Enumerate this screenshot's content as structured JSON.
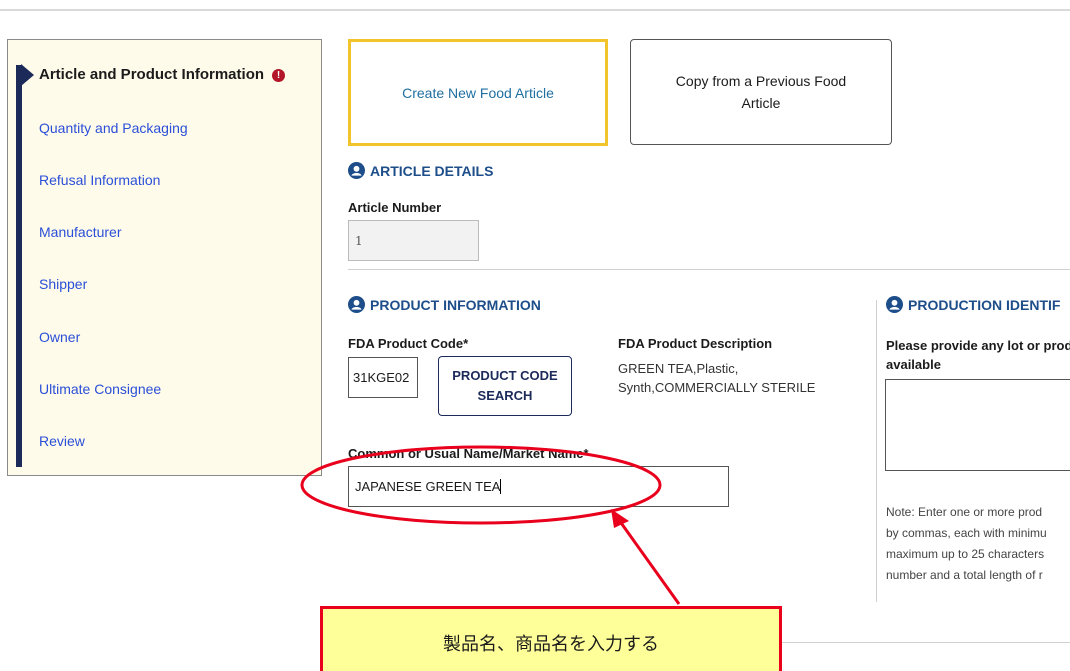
{
  "sidebar": {
    "items": [
      {
        "label": "Article and Product Information",
        "active": true,
        "alert": "!"
      },
      {
        "label": "Quantity and Packaging"
      },
      {
        "label": "Refusal Information"
      },
      {
        "label": "Manufacturer"
      },
      {
        "label": "Shipper"
      },
      {
        "label": "Owner"
      },
      {
        "label": "Ultimate Consignee"
      },
      {
        "label": "Review"
      }
    ]
  },
  "actions": {
    "create_new": "Create New Food Article",
    "copy_previous": "Copy from a Previous Food Article"
  },
  "article_details": {
    "heading": "ARTICLE DETAILS",
    "article_number_label": "Article Number",
    "article_number_value": "1"
  },
  "product_information": {
    "heading": "PRODUCT INFORMATION",
    "product_code_label": "FDA Product Code*",
    "product_code_value": "31KGE02",
    "search_button": "PRODUCT CODE SEARCH",
    "description_label": "FDA Product Description",
    "description_value": "GREEN TEA,Plastic, Synth,COMMERCIALLY STERILE",
    "name_label": "Common or Usual Name/Market Name*",
    "name_value": "JAPANESE GREEN TEA"
  },
  "production_identification": {
    "heading": "PRODUCTION IDENTIF",
    "prompt_line1": "Please provide any lot or prod",
    "prompt_line2": "available",
    "note_lines": [
      "Note: Enter one or more prod",
      "by commas, each with minimu",
      "maximum up to 25 characters",
      "number and a total length of r"
    ]
  },
  "annotation": {
    "callout_text": "製品名、商品名を入力する",
    "color": "#e8001c",
    "fill": "#ffff99"
  },
  "colors": {
    "sidebar_bg": "#fffbea",
    "nav_link": "#2a4fd8",
    "heading": "#1d4e8a",
    "highlight_border": "#f2c42b",
    "alert": "#b31628"
  }
}
